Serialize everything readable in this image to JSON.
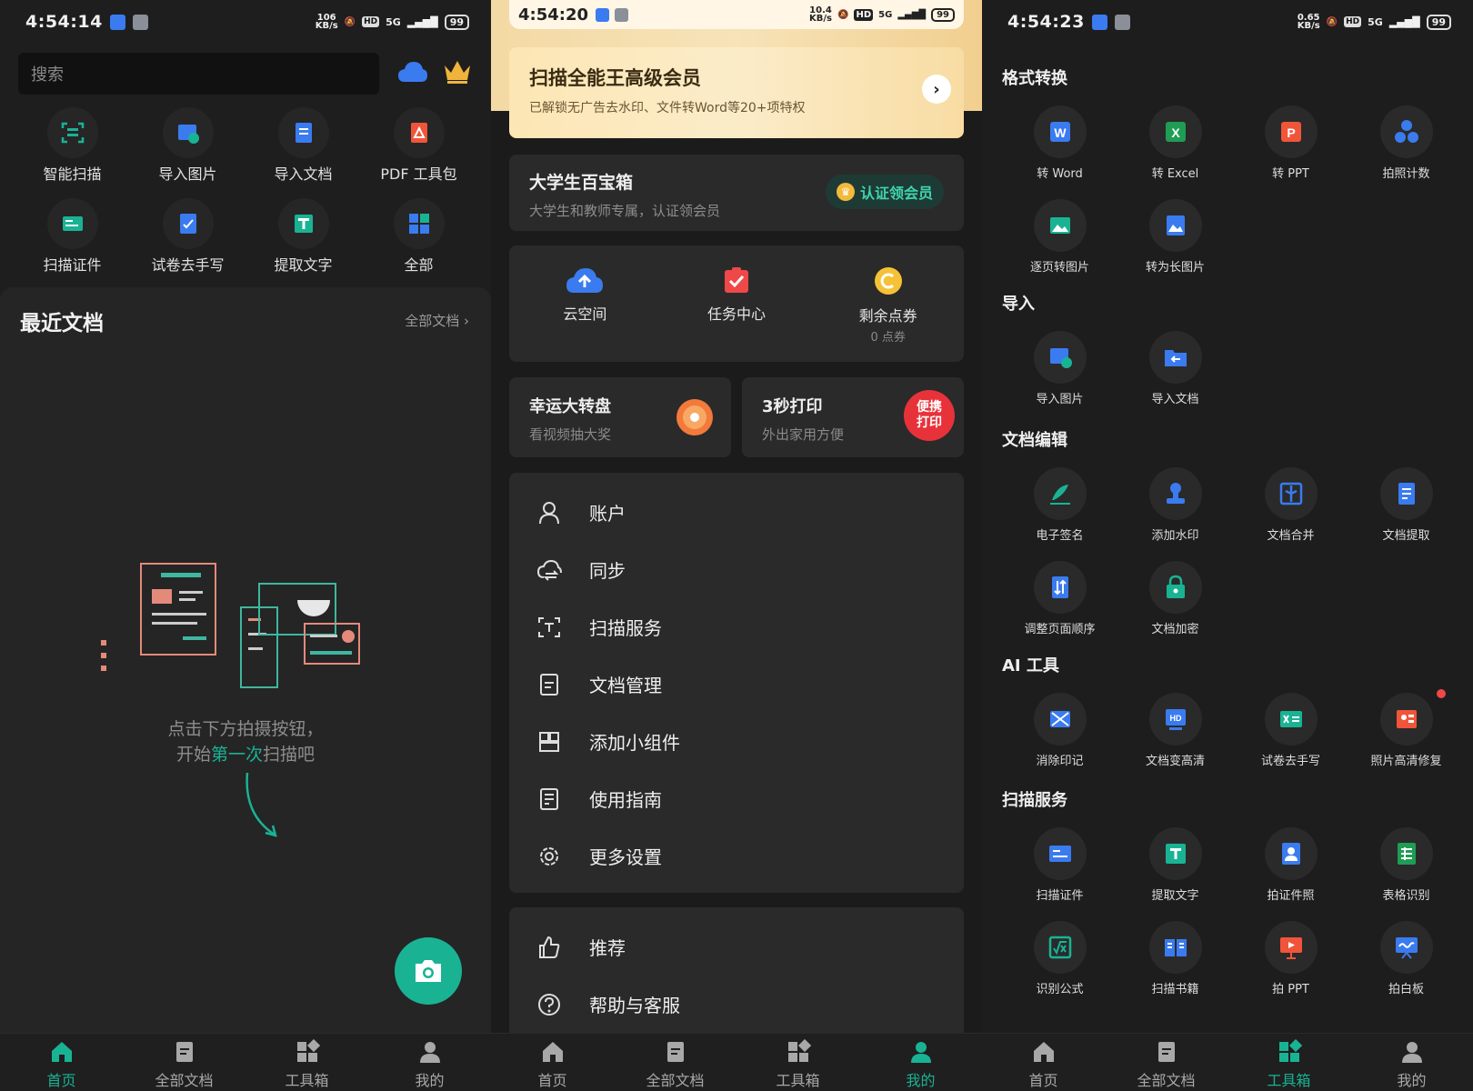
{
  "colors": {
    "accent": "#19b394",
    "vip_gold": "#f3d9a4",
    "danger": "#ef4848",
    "blue": "#3a7bf0"
  },
  "panel1": {
    "status": {
      "time": "4:54:14",
      "net": "106\nKB/s",
      "battery": "99",
      "signal": "5G"
    },
    "search_placeholder": "搜索",
    "quick": [
      {
        "label": "智能扫描",
        "icon": "scan-icon"
      },
      {
        "label": "导入图片",
        "icon": "image-import-icon"
      },
      {
        "label": "导入文档",
        "icon": "doc-import-icon"
      },
      {
        "label": "PDF 工具包",
        "icon": "pdf-icon"
      },
      {
        "label": "扫描证件",
        "icon": "id-card-icon"
      },
      {
        "label": "试卷去手写",
        "icon": "exam-icon"
      },
      {
        "label": "提取文字",
        "icon": "text-extract-icon"
      },
      {
        "label": "全部",
        "icon": "grid-icon"
      }
    ],
    "recent_title": "最近文档",
    "recent_all": "全部文档 ›",
    "hint_line1": "点击下方拍摄按钮，",
    "hint_line2_pre": "开始",
    "hint_line2_hl": "第一次",
    "hint_line2_post": "扫描吧"
  },
  "panel2": {
    "status": {
      "time": "4:54:20",
      "net": "10.4\nKB/s",
      "battery": "99",
      "signal": "5G"
    },
    "vip_title": "扫描全能王高级会员",
    "vip_sub": "已解锁无广告去水印、文件转Word等20+项特权",
    "student_title": "大学生百宝箱",
    "student_sub": "大学生和教师专属，认证领会员",
    "student_btn": "认证领会员",
    "cloud_label": "云空间",
    "task_label": "任务中心",
    "points_label": "剩余点券",
    "points_value": "0 点券",
    "lucky_title": "幸运大转盘",
    "lucky_sub": "看视频抽大奖",
    "print_title": "3秒打印",
    "print_sub": "外出家用方便",
    "print_badge": "便携\n打印",
    "menu": [
      "账户",
      "同步",
      "扫描服务",
      "文档管理",
      "添加小组件",
      "使用指南",
      "更多设置"
    ],
    "menu2": [
      "推荐",
      "帮助与客服"
    ]
  },
  "panel3": {
    "status": {
      "time": "4:54:23",
      "net": "0.65\nKB/s",
      "battery": "99",
      "signal": "5G"
    },
    "sections": [
      {
        "title": "格式转换",
        "items": [
          "转 Word",
          "转 Excel",
          "转 PPT",
          "拍照计数",
          "逐页转图片",
          "转为长图片"
        ]
      },
      {
        "title": "导入",
        "items": [
          "导入图片",
          "导入文档"
        ]
      },
      {
        "title": "文档编辑",
        "items": [
          "电子签名",
          "添加水印",
          "文档合并",
          "文档提取",
          "调整页面顺序",
          "文档加密"
        ]
      },
      {
        "title": "AI 工具",
        "items": [
          "消除印记",
          "文档变高清",
          "试卷去手写",
          "照片高清修复"
        ]
      },
      {
        "title": "扫描服务",
        "items": [
          "扫描证件",
          "提取文字",
          "拍证件照",
          "表格识别",
          "识别公式",
          "扫描书籍",
          "拍 PPT",
          "拍白板"
        ]
      }
    ]
  },
  "nav": [
    "首页",
    "全部文档",
    "工具箱",
    "我的"
  ]
}
